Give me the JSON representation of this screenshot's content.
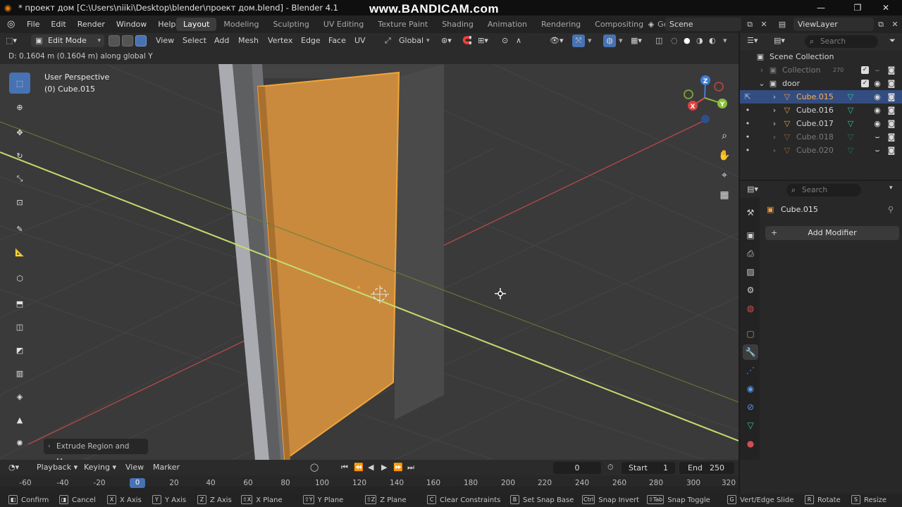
{
  "window": {
    "title": "* проект дом [C:\\Users\\niiki\\Desktop\\blender\\проект дом.blend] - Blender 4.1",
    "watermark": "www.BANDICAM.com"
  },
  "menu": [
    "File",
    "Edit",
    "Render",
    "Window",
    "Help"
  ],
  "workspaces": [
    "Layout",
    "Modeling",
    "Sculpting",
    "UV Editing",
    "Texture Paint",
    "Shading",
    "Animation",
    "Rendering",
    "Compositing",
    "Geom"
  ],
  "active_workspace": "Layout",
  "scene": "Scene",
  "view_layer": "ViewLayer",
  "viewport": {
    "mode": "Edit Mode",
    "menus": [
      "View",
      "Select",
      "Add",
      "Mesh",
      "Vertex",
      "Edge",
      "Face",
      "UV"
    ],
    "transform_orientation": "Global",
    "status_text": "D: 0.1604 m (0.1604 m) along global Y",
    "overlay_view": "User Perspective",
    "overlay_object": "(0) Cube.015",
    "last_operator": "Extrude Region and Move",
    "gizmo_axes": {
      "x": "X",
      "y": "Y",
      "z": "Z"
    }
  },
  "outliner": {
    "search_placeholder": "Search",
    "scene_collection": "Scene Collection",
    "rows": [
      {
        "name": "Collection",
        "count": "270",
        "dim": true
      },
      {
        "name": "door",
        "dim": false
      },
      {
        "name": "Cube.015",
        "selected": true
      },
      {
        "name": "Cube.016"
      },
      {
        "name": "Cube.017"
      },
      {
        "name": "Cube.018",
        "dim": true
      },
      {
        "name": "Cube.020",
        "dim": true
      }
    ]
  },
  "properties": {
    "search_placeholder": "Search",
    "object_name": "Cube.015",
    "add_modifier": "Add Modifier"
  },
  "timeline": {
    "menus": [
      "Playback",
      "Keying",
      "View",
      "Marker"
    ],
    "current_frame": "0",
    "start_label": "Start",
    "start": "1",
    "end_label": "End",
    "end": "250",
    "ruler": [
      "-60",
      "-40",
      "-20",
      "0",
      "20",
      "40",
      "60",
      "80",
      "100",
      "120",
      "140",
      "160",
      "180",
      "200",
      "220",
      "240",
      "260",
      "280",
      "300",
      "320"
    ]
  },
  "statusbar": [
    {
      "key": "",
      "label": "Confirm"
    },
    {
      "key": "",
      "label": "Cancel"
    },
    {
      "key": "X",
      "label": "X Axis"
    },
    {
      "key": "Y",
      "label": "Y Axis"
    },
    {
      "key": "Z",
      "label": "Z Axis"
    },
    {
      "key": "⇧X",
      "label": "X Plane"
    },
    {
      "key": "⇧Y",
      "label": "Y Plane"
    },
    {
      "key": "⇧Z",
      "label": "Z Plane"
    },
    {
      "key": "C",
      "label": "Clear Constraints"
    },
    {
      "key": "B",
      "label": "Set Snap Base"
    },
    {
      "key": "Ctrl",
      "label": "Snap Invert"
    },
    {
      "key": "⇧Tab",
      "label": "Snap Toggle"
    },
    {
      "key": "G",
      "label": "Vert/Edge Slide"
    },
    {
      "key": "R",
      "label": "Rotate"
    },
    {
      "key": "S",
      "label": "Resize"
    }
  ],
  "colors": {
    "accent_blue": "#4772b3",
    "selection_orange": "#e89a3c",
    "face_fill": "#c98a3e",
    "axis_x": "#d04a4a",
    "axis_y": "#b9d36a"
  }
}
